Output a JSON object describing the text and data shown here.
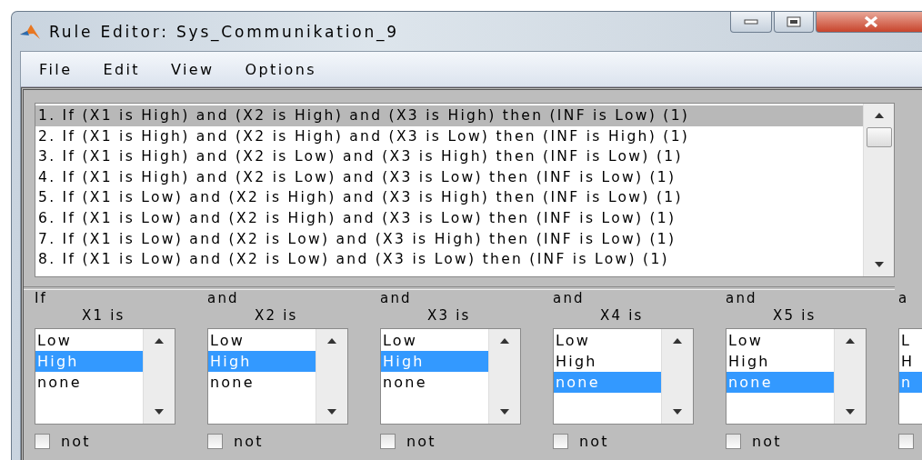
{
  "window": {
    "title": "Rule Editor: Sys_Communikation_9"
  },
  "menu": [
    "File",
    "Edit",
    "View",
    "Options"
  ],
  "rules": [
    {
      "text": "1. If (X1 is High) and (X2 is High) and (X3 is High) then (INF is Low) (1)",
      "selected": true
    },
    {
      "text": "2. If (X1 is High) and (X2 is High) and (X3 is Low) then (INF is High) (1)",
      "selected": false
    },
    {
      "text": "3. If (X1 is High) and (X2 is Low) and (X3 is High) then (INF is Low) (1)",
      "selected": false
    },
    {
      "text": "4. If (X1 is High) and (X2 is Low) and (X3 is Low) then (INF is Low) (1)",
      "selected": false
    },
    {
      "text": "5. If (X1 is Low) and (X2 is High) and (X3 is High) then (INF is Low) (1)",
      "selected": false
    },
    {
      "text": "6. If (X1 is Low) and (X2 is High) and (X3 is Low) then (INF is Low) (1)",
      "selected": false
    },
    {
      "text": "7. If (X1 is Low) and (X2 is Low) and (X3 is High) then (INF is Low) (1)",
      "selected": false
    },
    {
      "text": "8. If (X1 is Low) and (X2 is Low) and (X3 is Low) then (INF is Low) (1)",
      "selected": false
    }
  ],
  "inputs": [
    {
      "connector": "If",
      "variable": "X1 is",
      "scrollbar": true,
      "options": [
        {
          "label": "Low",
          "selected": false
        },
        {
          "label": "High",
          "selected": true
        },
        {
          "label": "none",
          "selected": false
        }
      ],
      "not": {
        "label": "not",
        "checked": false
      }
    },
    {
      "connector": "and",
      "variable": "X2 is",
      "scrollbar": true,
      "options": [
        {
          "label": "Low",
          "selected": false
        },
        {
          "label": "High",
          "selected": true
        },
        {
          "label": "none",
          "selected": false
        }
      ],
      "not": {
        "label": "not",
        "checked": false
      }
    },
    {
      "connector": "and",
      "variable": "X3 is",
      "scrollbar": true,
      "options": [
        {
          "label": "Low",
          "selected": false
        },
        {
          "label": "High",
          "selected": true
        },
        {
          "label": "none",
          "selected": false
        }
      ],
      "not": {
        "label": "not",
        "checked": false
      }
    },
    {
      "connector": "and",
      "variable": "X4 is",
      "scrollbar": true,
      "options": [
        {
          "label": "Low",
          "selected": false
        },
        {
          "label": "High",
          "selected": false
        },
        {
          "label": "none",
          "selected": true
        }
      ],
      "not": {
        "label": "not",
        "checked": false
      }
    },
    {
      "connector": "and",
      "variable": "X5 is",
      "scrollbar": true,
      "options": [
        {
          "label": "Low",
          "selected": false
        },
        {
          "label": "High",
          "selected": false
        },
        {
          "label": "none",
          "selected": true
        }
      ],
      "not": {
        "label": "not",
        "checked": false
      }
    },
    {
      "connector": "a",
      "scrollbar": false,
      "options": [
        {
          "label": "L",
          "selected": false
        },
        {
          "label": "H",
          "selected": false
        },
        {
          "label": "n",
          "selected": true
        }
      ],
      "not": {
        "checked": false
      }
    }
  ]
}
